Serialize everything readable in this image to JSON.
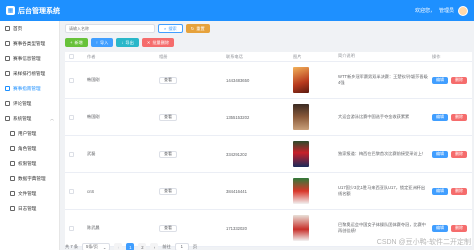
{
  "header": {
    "title": "后台管理系统",
    "welcome": "欢迎您，",
    "user": "管理员"
  },
  "sidebar": {
    "items": [
      {
        "label": "首页",
        "icon": "home-icon"
      },
      {
        "label": "赛事各类型管理",
        "icon": "grid-icon"
      },
      {
        "label": "赛事信息管理",
        "icon": "grid-icon"
      },
      {
        "label": "采样排行榜管理",
        "icon": "grid-icon"
      },
      {
        "label": "赛事指南管理",
        "icon": "grid-icon",
        "active": true
      },
      {
        "label": "评论管理",
        "icon": "grid-icon"
      },
      {
        "label": "系统管理",
        "icon": "grid-icon"
      },
      {
        "label": "用户管理",
        "icon": "user-icon"
      },
      {
        "label": "角色管理",
        "icon": "user-icon"
      },
      {
        "label": "权限管理",
        "icon": "lock-icon"
      },
      {
        "label": "数据字典管理",
        "icon": "book-icon"
      },
      {
        "label": "文件管理",
        "icon": "file-icon"
      },
      {
        "label": "日志管理",
        "icon": "log-icon"
      }
    ]
  },
  "search": {
    "placeholder": "请输入名称",
    "search_label": "搜索",
    "reset_label": "重置"
  },
  "actions": {
    "add": "新增",
    "import": "导入",
    "export": "导出",
    "batch_delete": "批量删除"
  },
  "table": {
    "columns": [
      "作者",
      "相册",
      "联系电话",
      "图片",
      "简介说明",
      "操作"
    ],
    "view_label": "查看",
    "edit_label": "编辑",
    "delete_label": "删除",
    "rows": [
      {
        "author": "韩国刚",
        "tel": "1443483650",
        "desc": "WTT新乡冠军赛男双半决赛：王楚钦/孙颖莎晋级4强"
      },
      {
        "author": "韩国刚",
        "tel": "1355153202",
        "desc": "大运会游泳比赛中国选手夺金收获累累"
      },
      {
        "author": "武磊",
        "tel": "334291202",
        "desc": "独家报道：梅西在巴黎首次比赛前接受采访上！"
      },
      {
        "author": "cnS",
        "tel": "384416441",
        "desc": "U17国少3比1胜马来西亚队U17，锁定亚洲杯出线名额"
      },
      {
        "author": "陈武晨",
        "tel": "171332020",
        "desc": "巴黎奥运会中国女子体操队团体赛夺冠，比赛中再创佳绩！"
      }
    ]
  },
  "pager": {
    "total": "共 7 条",
    "page_size": "5条/页",
    "pages": [
      "1",
      "2"
    ],
    "goto": "前往",
    "goto_value": "1",
    "page_unit": "页"
  },
  "watermark": "CSDN @豆小鸭-软件二开定制"
}
